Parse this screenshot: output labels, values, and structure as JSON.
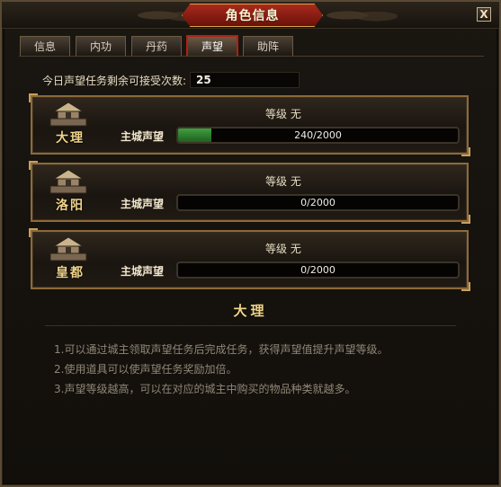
{
  "window": {
    "title": "角色信息",
    "close_label": "X"
  },
  "tabs": [
    {
      "label": "信息",
      "active": false
    },
    {
      "label": "内功",
      "active": false
    },
    {
      "label": "丹药",
      "active": false
    },
    {
      "label": "声望",
      "active": true
    },
    {
      "label": "助阵",
      "active": false
    }
  ],
  "daily": {
    "label": "今日声望任务剩余可接受次数:",
    "value": "25"
  },
  "cities": [
    {
      "name": "大理",
      "level_text": "等级 无",
      "rep_label": "主城声望",
      "progress_text": "240/2000",
      "current": 240,
      "max": 2000,
      "icon": "city-building-icon"
    },
    {
      "name": "洛阳",
      "level_text": "等级 无",
      "rep_label": "主城声望",
      "progress_text": "0/2000",
      "current": 0,
      "max": 2000,
      "icon": "city-building-icon"
    },
    {
      "name": "皇都",
      "level_text": "等级 无",
      "rep_label": "主城声望",
      "progress_text": "0/2000",
      "current": 0,
      "max": 2000,
      "icon": "city-building-icon"
    }
  ],
  "selected_city": "大理",
  "notes": [
    "1.可以通过城主领取声望任务后完成任务，获得声望值提升声望等级。",
    "2.使用道具可以使声望任务奖励加倍。",
    "3.声望等级越高，可以在对应的城主中购买的物品种类就越多。"
  ],
  "colors": {
    "accent_red": "#b41f12",
    "progress_green": "#3fa03f",
    "gold": "#f0d48a"
  }
}
